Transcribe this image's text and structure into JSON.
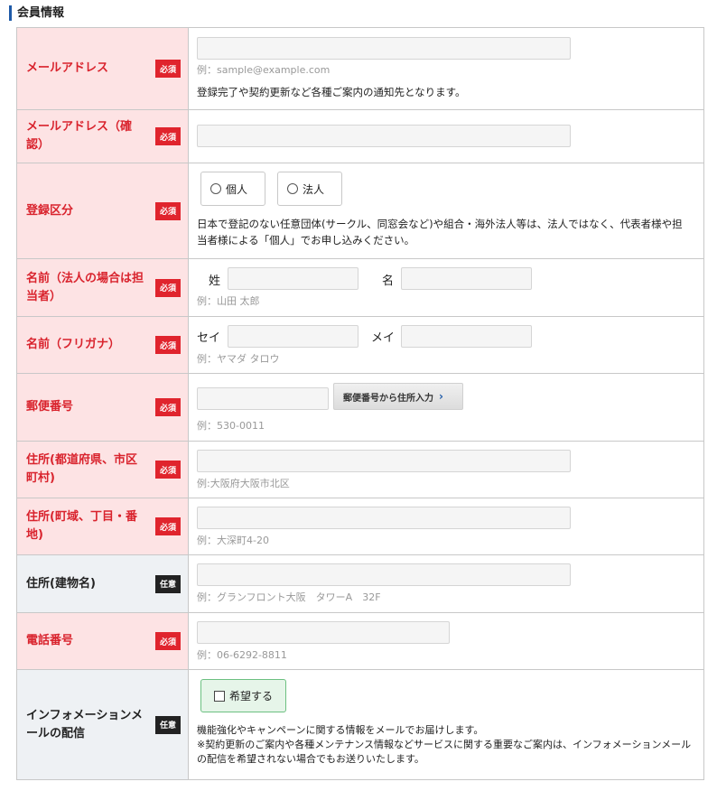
{
  "section_title": "会員情報",
  "badges": {
    "required": "必須",
    "optional": "任意"
  },
  "email": {
    "label": "メールアドレス",
    "value": "",
    "example": "例：sample@example.com",
    "note": "登録完了や契約更新など各種ご案内の通知先となります。"
  },
  "email_confirm": {
    "label": "メールアドレス（確認）",
    "value": ""
  },
  "reg_type": {
    "label": "登録区分",
    "options": [
      "個人",
      "法人"
    ],
    "note": "日本で登記のない任意団体(サークル、同窓会など)や組合・海外法人等は、法人ではなく、代表者様や担当者様による「個人」でお申し込みください。"
  },
  "name": {
    "label": "名前（法人の場合は担当者）",
    "last_label": "姓",
    "first_label": "名",
    "example": "例：山田 太郎"
  },
  "kana": {
    "label": "名前（フリガナ）",
    "last_label": "セイ",
    "first_label": "メイ",
    "example": "例：ヤマダ タロウ"
  },
  "zip": {
    "label": "郵便番号",
    "button": "郵便番号から住所入力",
    "example": "例：530-0011"
  },
  "pref": {
    "label": "住所(都道府県、市区町村)",
    "example": "例:大阪府大阪市北区"
  },
  "town": {
    "label": "住所(町域、丁目・番地)",
    "example": "例：大深町4-20"
  },
  "building": {
    "label": "住所(建物名)",
    "example": "例：グランフロント大阪　タワーA　32F"
  },
  "tel": {
    "label": "電話番号",
    "example": "例：06-6292-8811"
  },
  "info_mail": {
    "label": "インフォメーションメールの配信",
    "checkbox": "希望する",
    "note1": "機能強化やキャンペーンに関する情報をメールでお届けします。",
    "note2": "※契約更新のご案内や各種メンテナンス情報などサービスに関する重要なご案内は、インフォメーションメールの配信を希望されない場合でもお送りいたします。"
  },
  "colors": {
    "required_bg": "#fde3e4",
    "optional_bg": "#eef1f4",
    "required_text": "#d9232d",
    "badge_required": "#e0242d",
    "badge_optional": "#222222",
    "accent": "#1e5aa8"
  }
}
